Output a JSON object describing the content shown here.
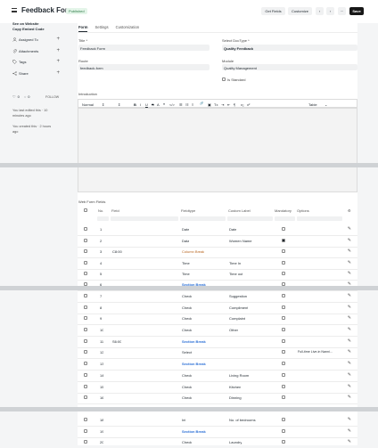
{
  "header": {
    "title": "Feedback Form",
    "status": "Published",
    "get_fields": "Get Fields",
    "customize": "Customize",
    "prev": "‹",
    "next": "›",
    "more": "···",
    "save": "Save"
  },
  "sidebar": {
    "see_on_website": "See on Website",
    "copy_embed": "Copy Embed Code",
    "assigned": "Assigned To",
    "attachments": "Attachments",
    "tags": "Tags",
    "share": "Share",
    "likes": "0",
    "comments": "0",
    "follow": "FOLLOW",
    "edited": "You last edited this · 10 minutes ago",
    "created": "You created this · 2 hours ago"
  },
  "tabs": [
    "Form",
    "Settings",
    "Customization"
  ],
  "form": {
    "title_label": "Title *",
    "title_value": "Feedback Form",
    "doctype_label": "Select DocType *",
    "doctype_value": "Quality Feedback",
    "route_label": "Route",
    "route_value": "feedback-form",
    "module_label": "Module",
    "module_value": "Quality Management",
    "is_standard": "Is Standard",
    "intro_label": "Introduction"
  },
  "editor": {
    "style": "Normal",
    "size": "⇕",
    "font": "⇕",
    "bold": "B",
    "italic": "I",
    "underline": "U",
    "strike": "S",
    "quote": "❝",
    "code": "</>",
    "list_ol": "☰",
    "list_ul": "☷",
    "link": "🔗",
    "image": "▣",
    "table": "Table"
  },
  "grid": {
    "title": "Web Form Fields",
    "columns": [
      "No.",
      "Field",
      "Fieldtype",
      "Custom Label",
      "Mandatory",
      "Options"
    ],
    "rows": [
      {
        "no": "1",
        "field": "",
        "fieldtype": "Date",
        "label": "Date",
        "mandatory": false,
        "options": "",
        "kind": ""
      },
      {
        "no": "2",
        "field": "",
        "fieldtype": "Data",
        "label": "Women Name",
        "mandatory": true,
        "options": "",
        "kind": ""
      },
      {
        "no": "3",
        "field": "C8:00",
        "fieldtype": "Column Break",
        "label": "",
        "mandatory": false,
        "options": "",
        "kind": "col"
      },
      {
        "no": "4",
        "field": "",
        "fieldtype": "Time",
        "label": "Time In",
        "mandatory": false,
        "options": "",
        "kind": ""
      },
      {
        "no": "5",
        "field": "",
        "fieldtype": "Time",
        "label": "Time out",
        "mandatory": false,
        "options": "",
        "kind": ""
      },
      {
        "no": "6",
        "field": "",
        "fieldtype": "Section Break",
        "label": "",
        "mandatory": false,
        "options": "",
        "kind": "sec"
      },
      {
        "no": "7",
        "field": "",
        "fieldtype": "Check",
        "label": "Suggestion",
        "mandatory": false,
        "options": "",
        "kind": ""
      },
      {
        "no": "8",
        "field": "",
        "fieldtype": "Check",
        "label": "Compliment",
        "mandatory": false,
        "options": "",
        "kind": ""
      },
      {
        "no": "9",
        "field": "",
        "fieldtype": "Check",
        "label": "Complaint",
        "mandatory": false,
        "options": "",
        "kind": ""
      },
      {
        "no": "10",
        "field": "",
        "fieldtype": "Check",
        "label": "Other",
        "mandatory": false,
        "options": "",
        "kind": ""
      },
      {
        "no": "11",
        "field": "S6:00",
        "fieldtype": "Section Break",
        "label": "",
        "mandatory": false,
        "options": "",
        "kind": "sec"
      },
      {
        "no": "12",
        "field": "",
        "fieldtype": "Select",
        "label": "",
        "mandatory": false,
        "options": "Full-time Live-in Nanni…",
        "kind": ""
      },
      {
        "no": "13",
        "field": "",
        "fieldtype": "Section Break",
        "label": "",
        "mandatory": false,
        "options": "",
        "kind": "sec"
      },
      {
        "no": "14",
        "field": "",
        "fieldtype": "Check",
        "label": "Living Room",
        "mandatory": false,
        "options": "",
        "kind": ""
      },
      {
        "no": "15",
        "field": "",
        "fieldtype": "Check",
        "label": "Kitchen",
        "mandatory": false,
        "options": "",
        "kind": ""
      },
      {
        "no": "16",
        "field": "",
        "fieldtype": "Check",
        "label": "Dinning",
        "mandatory": false,
        "options": "",
        "kind": ""
      },
      {
        "no": "18",
        "field": "",
        "fieldtype": "Int",
        "label": "No. of bedrooms",
        "mandatory": false,
        "options": "",
        "kind": ""
      },
      {
        "no": "19",
        "field": "",
        "fieldtype": "Section Break",
        "label": "",
        "mandatory": false,
        "options": "",
        "kind": "sec"
      },
      {
        "no": "20",
        "field": "",
        "fieldtype": "Check",
        "label": "Laundry",
        "mandatory": false,
        "options": "",
        "kind": ""
      }
    ]
  },
  "colors": {
    "accent": "#171717",
    "section_break": "#2b6fd6",
    "column_break": "#b8651f",
    "published": "#2d7a47"
  },
  "icons": {
    "assigned": "person-icon",
    "attachments": "paperclip-icon",
    "tags": "tag-icon",
    "share": "share-icon",
    "like": "heart-icon",
    "comment": "comment-icon",
    "edit": "edit-icon"
  }
}
